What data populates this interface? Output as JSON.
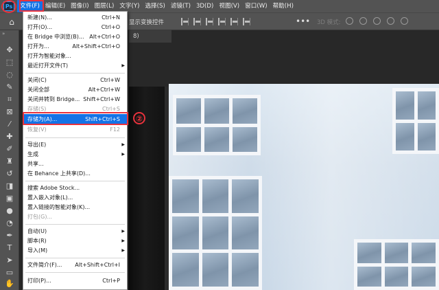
{
  "menubar": {
    "logo": "Ps",
    "items": [
      {
        "label": "文件(F)"
      },
      {
        "label": "编辑(E)"
      },
      {
        "label": "图像(I)"
      },
      {
        "label": "图层(L)"
      },
      {
        "label": "文字(Y)"
      },
      {
        "label": "选择(S)"
      },
      {
        "label": "滤镜(T)"
      },
      {
        "label": "3D(D)"
      },
      {
        "label": "视图(V)"
      },
      {
        "label": "窗口(W)"
      },
      {
        "label": "帮助(H)"
      }
    ]
  },
  "options_bar": {
    "show_transform_controls": "显示变换控件",
    "mode_3d": "3D 模式:"
  },
  "document": {
    "tab_label": "8)"
  },
  "file_menu": {
    "items": [
      {
        "label": "新建(N)...",
        "shortcut": "Ctrl+N"
      },
      {
        "label": "打开(O)...",
        "shortcut": "Ctrl+O"
      },
      {
        "label": "在 Bridge 中浏览(B)...",
        "shortcut": "Alt+Ctrl+O"
      },
      {
        "label": "打开为...",
        "shortcut": "Alt+Shift+Ctrl+O"
      },
      {
        "label": "打开为智能对象..."
      },
      {
        "label": "最近打开文件(T)"
      },
      {
        "label": "关闭(C)",
        "shortcut": "Ctrl+W"
      },
      {
        "label": "关闭全部",
        "shortcut": "Alt+Ctrl+W"
      },
      {
        "label": "关闭并转到 Bridge...",
        "shortcut": "Shift+Ctrl+W"
      },
      {
        "label": "存储(S)",
        "shortcut": "Ctrl+S"
      },
      {
        "label": "存储为(A)...",
        "shortcut": "Shift+Ctrl+S"
      },
      {
        "label": "恢复(V)",
        "shortcut": "F12"
      },
      {
        "label": "导出(E)"
      },
      {
        "label": "生成"
      },
      {
        "label": "共享..."
      },
      {
        "label": "在 Behance 上共享(D)..."
      },
      {
        "label": "搜索 Adobe Stock..."
      },
      {
        "label": "置入嵌入对象(L)..."
      },
      {
        "label": "置入链接的智能对象(K)..."
      },
      {
        "label": "打包(G)..."
      },
      {
        "label": "自动(U)"
      },
      {
        "label": "脚本(R)"
      },
      {
        "label": "导入(M)"
      },
      {
        "label": "文件简介(F)...",
        "shortcut": "Alt+Shift+Ctrl+I"
      },
      {
        "label": "打印(P)...",
        "shortcut": "Ctrl+P"
      }
    ]
  },
  "annotation": {
    "step_number": "②",
    "color": "#e8323c"
  },
  "colors": {
    "accent": "#1473e6",
    "chrome": "#535353",
    "workspace": "#282828"
  }
}
